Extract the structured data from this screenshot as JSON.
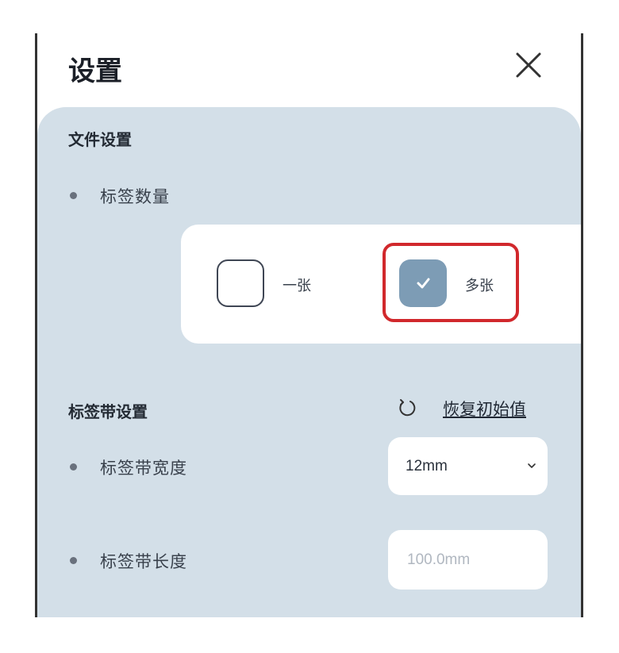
{
  "header": {
    "title": "设置"
  },
  "file_settings": {
    "title": "文件设置",
    "label_count": {
      "label": "标签数量",
      "options": [
        {
          "label": "一张",
          "checked": false
        },
        {
          "label": "多张",
          "checked": true
        }
      ]
    }
  },
  "tape_settings": {
    "title": "标签带设置",
    "reset_label": "恢复初始值",
    "width": {
      "label": "标签带宽度",
      "value": "12mm"
    },
    "length": {
      "label": "标签带长度",
      "placeholder": "100.0mm"
    }
  },
  "colors": {
    "panel_bg": "#d3dfe8",
    "checked_bg": "#7d9cb5",
    "highlight": "#d1282c"
  }
}
